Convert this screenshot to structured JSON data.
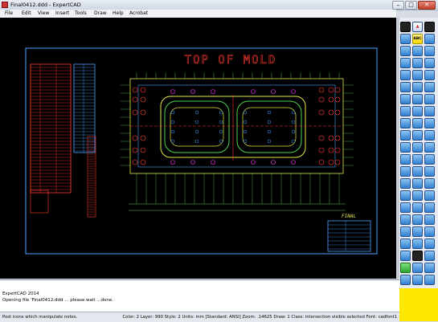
{
  "window": {
    "title": "Final0412.ddd - ExpertCAD",
    "minimize_glyph": "–",
    "maximize_glyph": "□",
    "close_glyph": "✕"
  },
  "menu": [
    "File",
    "Edit",
    "View",
    "Insert",
    "Tools",
    "Draw",
    "Help",
    "Acrobat"
  ],
  "drawing": {
    "title": "TOP OF MOLD",
    "stamp_text": "FINAL"
  },
  "console": {
    "lines": [
      "ExpertCAD 2014",
      "Opening file 'Final0412.ddd ... please wait ...done."
    ]
  },
  "status": {
    "hint": "Post icons which manipulate notes.",
    "info": "Color: 2  Layer: 990  Style: 2  Units: mm  [Standard: ANSI] Zoom: .14625  Draw: 1  Class: intersection visible selected  Font: cadfont1"
  },
  "toolbox": {
    "text_tool_label": "ABC",
    "icons": [
      "select-arrow-icon",
      "triangle-icon",
      "black-swatch-icon",
      "text-abc-icon"
    ]
  }
}
